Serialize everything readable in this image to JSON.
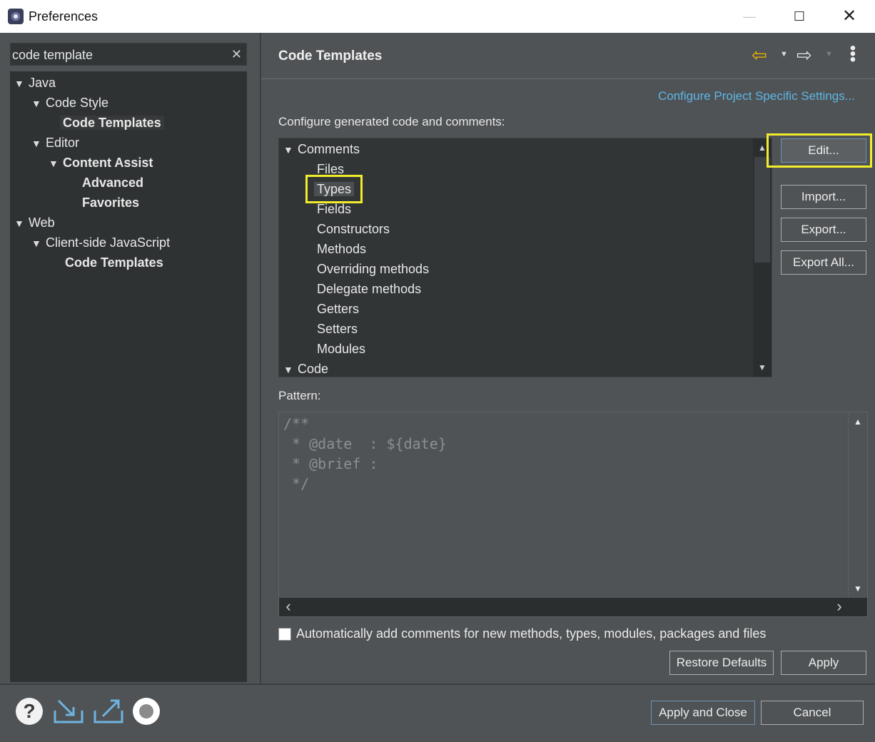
{
  "window": {
    "title": "Preferences",
    "minimize": "—",
    "maximize": "☐",
    "close": "✕"
  },
  "filter": {
    "value": "code template",
    "clear": "✕"
  },
  "left_tree": [
    {
      "label": "Java",
      "expanded": true
    },
    {
      "label": "Code Style",
      "expanded": true
    },
    {
      "label": "Code Templates",
      "selected": true
    },
    {
      "label": "Editor",
      "expanded": true
    },
    {
      "label": "Content Assist",
      "expanded": true
    },
    {
      "label": "Advanced"
    },
    {
      "label": "Favorites"
    },
    {
      "label": "Web",
      "expanded": true
    },
    {
      "label": "Client-side JavaScript",
      "expanded": true
    },
    {
      "label": "Code Templates"
    }
  ],
  "page": {
    "title": "Code Templates",
    "project_link": "Configure Project Specific Settings...",
    "configure_label": "Configure generated code and comments:"
  },
  "template_tree": [
    {
      "label": "Comments",
      "expanded": true
    },
    {
      "label": "Files"
    },
    {
      "label": "Types",
      "selected": true
    },
    {
      "label": "Fields"
    },
    {
      "label": "Constructors"
    },
    {
      "label": "Methods"
    },
    {
      "label": "Overriding methods"
    },
    {
      "label": "Delegate methods"
    },
    {
      "label": "Getters"
    },
    {
      "label": "Setters"
    },
    {
      "label": "Modules"
    },
    {
      "label": "Code",
      "expanded": true
    }
  ],
  "buttons": {
    "edit": "Edit...",
    "import": "Import...",
    "export": "Export...",
    "export_all": "Export All...",
    "restore_defaults": "Restore Defaults",
    "apply": "Apply",
    "apply_close": "Apply and Close",
    "cancel": "Cancel"
  },
  "pattern": {
    "label": "Pattern:",
    "lines": [
      "/**",
      " * @date  : ${date}",
      " * @brief :",
      " */"
    ]
  },
  "auto_comments": {
    "label": "Automatically add comments for new methods, types, modules, packages and files",
    "checked": false
  },
  "icons": {
    "help": "?",
    "chevron_down": "▼",
    "chevron_up": "▲",
    "chevron_left": "‹",
    "chevron_right": "›",
    "back_arrow": "⇦",
    "forward_arrow": "⇨",
    "menu": "⋮"
  },
  "colors": {
    "highlight": "#f2ec2c",
    "link": "#5fb6e6",
    "back_arrow": "#f5b400"
  }
}
